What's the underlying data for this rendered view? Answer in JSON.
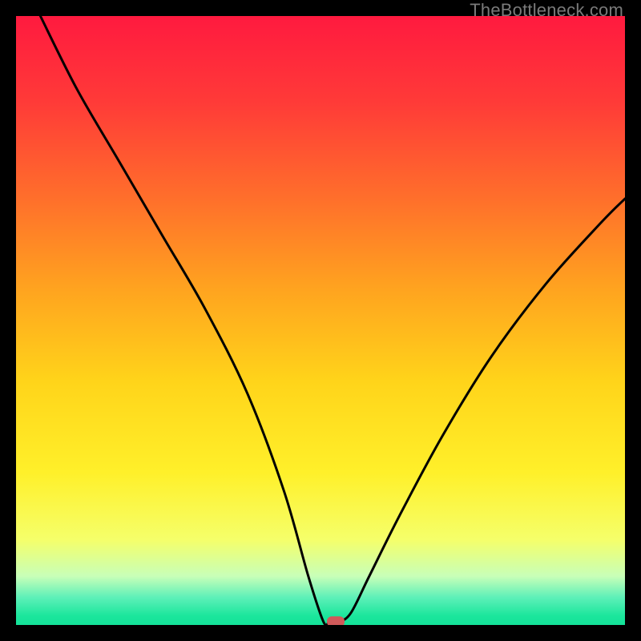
{
  "watermark": "TheBottleneck.com",
  "chart_data": {
    "type": "line",
    "title": "",
    "xlabel": "",
    "ylabel": "",
    "xlim": [
      0,
      100
    ],
    "ylim": [
      0,
      100
    ],
    "grid": false,
    "series": [
      {
        "name": "curve",
        "x": [
          4,
          10,
          17,
          24,
          31,
          38,
          44,
          48,
          50.5,
          51.5,
          53,
          55,
          58,
          63,
          70,
          78,
          87,
          96,
          100
        ],
        "y": [
          100,
          88,
          76,
          64,
          52,
          38,
          22,
          8,
          0.5,
          0.5,
          0.5,
          2,
          8,
          18,
          31,
          44,
          56,
          66,
          70
        ]
      }
    ],
    "background_gradient": {
      "stops": [
        {
          "offset": 0.0,
          "color": "#ff1a3f"
        },
        {
          "offset": 0.14,
          "color": "#ff3a38"
        },
        {
          "offset": 0.3,
          "color": "#ff6f2b"
        },
        {
          "offset": 0.45,
          "color": "#ffa41f"
        },
        {
          "offset": 0.6,
          "color": "#ffd41a"
        },
        {
          "offset": 0.75,
          "color": "#fff02a"
        },
        {
          "offset": 0.86,
          "color": "#f5ff6a"
        },
        {
          "offset": 0.92,
          "color": "#c8ffb8"
        },
        {
          "offset": 0.955,
          "color": "#5df0b8"
        },
        {
          "offset": 0.985,
          "color": "#1be69c"
        },
        {
          "offset": 1.0,
          "color": "#14e299"
        }
      ]
    },
    "marker": {
      "x": 52.5,
      "y": 0.5,
      "color": "#d05a5a"
    }
  }
}
